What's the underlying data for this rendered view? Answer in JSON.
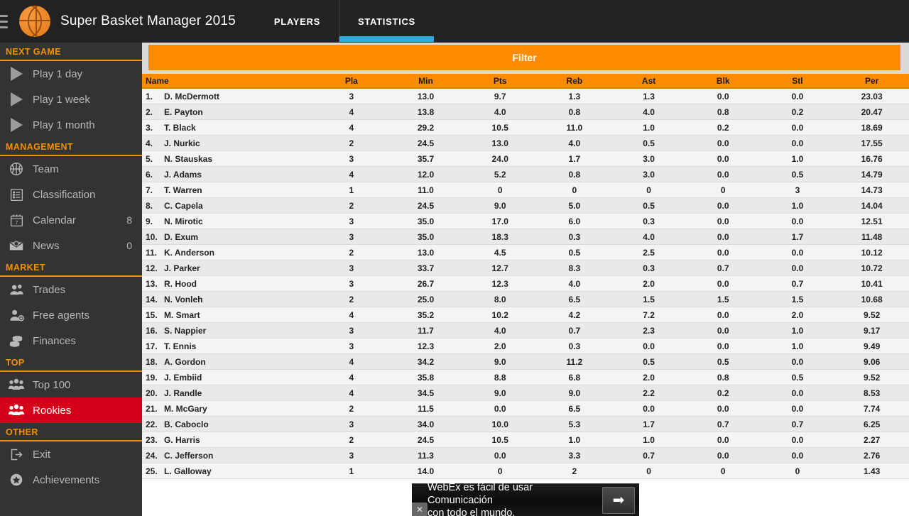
{
  "header": {
    "menu_icon": "hamburger-icon",
    "logo_icon": "basketball-logo-icon",
    "title": "Super Basket Manager 2015",
    "tabs": [
      {
        "label": "PLAYERS",
        "active": false
      },
      {
        "label": "STATISTICS",
        "active": true
      }
    ],
    "accent_tab_color": "#2fadda",
    "bar_color": "#222222"
  },
  "sidebar": {
    "bg_color": "#333333",
    "section_color": "#f39200",
    "selected_color": "#d50019",
    "groups": [
      {
        "title": "NEXT GAME",
        "items": [
          {
            "label": "Play 1 day",
            "icon": "play-icon",
            "badge": ""
          },
          {
            "label": "Play 1 week",
            "icon": "play-icon",
            "badge": ""
          },
          {
            "label": "Play 1 month",
            "icon": "play-icon",
            "badge": ""
          }
        ]
      },
      {
        "title": "MANAGEMENT",
        "items": [
          {
            "label": "Team",
            "icon": "basketball-icon",
            "badge": ""
          },
          {
            "label": "Classification",
            "icon": "list-icon",
            "badge": ""
          },
          {
            "label": "Calendar",
            "icon": "calendar-icon",
            "badge": "8"
          },
          {
            "label": "News",
            "icon": "mail-icon",
            "badge": "0"
          }
        ]
      },
      {
        "title": "MARKET",
        "items": [
          {
            "label": "Trades",
            "icon": "two-people-icon",
            "badge": ""
          },
          {
            "label": "Free agents",
            "icon": "person-add-icon",
            "badge": ""
          },
          {
            "label": "Finances",
            "icon": "coins-icon",
            "badge": ""
          }
        ]
      },
      {
        "title": "TOP",
        "items": [
          {
            "label": "Top 100",
            "icon": "three-people-icon",
            "badge": "",
            "selected": false
          },
          {
            "label": "Rookies",
            "icon": "three-people-icon",
            "badge": "",
            "selected": true
          }
        ]
      },
      {
        "title": "OTHER",
        "items": [
          {
            "label": "Exit",
            "icon": "exit-icon",
            "badge": ""
          },
          {
            "label": "Achievements",
            "icon": "star-icon",
            "badge": ""
          }
        ]
      }
    ]
  },
  "main": {
    "filter_label": "Filter",
    "filter_color": "#ff8c00",
    "columns": [
      "Name",
      "Pla",
      "Min",
      "Pts",
      "Reb",
      "Ast",
      "Blk",
      "Stl",
      "Per"
    ],
    "rows": [
      {
        "rank": "1.",
        "name": "D. McDermott",
        "pla": "3",
        "min": "13.0",
        "pts": "9.7",
        "reb": "1.3",
        "ast": "1.3",
        "blk": "0.0",
        "stl": "0.0",
        "per": "23.03"
      },
      {
        "rank": "2.",
        "name": "E. Payton",
        "pla": "4",
        "min": "13.8",
        "pts": "4.0",
        "reb": "0.8",
        "ast": "4.0",
        "blk": "0.8",
        "stl": "0.2",
        "per": "20.47"
      },
      {
        "rank": "3.",
        "name": "T. Black",
        "pla": "4",
        "min": "29.2",
        "pts": "10.5",
        "reb": "11.0",
        "ast": "1.0",
        "blk": "0.2",
        "stl": "0.0",
        "per": "18.69"
      },
      {
        "rank": "4.",
        "name": "J. Nurkic",
        "pla": "2",
        "min": "24.5",
        "pts": "13.0",
        "reb": "4.0",
        "ast": "0.5",
        "blk": "0.0",
        "stl": "0.0",
        "per": "17.55"
      },
      {
        "rank": "5.",
        "name": "N. Stauskas",
        "pla": "3",
        "min": "35.7",
        "pts": "24.0",
        "reb": "1.7",
        "ast": "3.0",
        "blk": "0.0",
        "stl": "1.0",
        "per": "16.76"
      },
      {
        "rank": "6.",
        "name": "J. Adams",
        "pla": "4",
        "min": "12.0",
        "pts": "5.2",
        "reb": "0.8",
        "ast": "3.0",
        "blk": "0.0",
        "stl": "0.5",
        "per": "14.79"
      },
      {
        "rank": "7.",
        "name": "T. Warren",
        "pla": "1",
        "min": "11.0",
        "pts": "0",
        "reb": "0",
        "ast": "0",
        "blk": "0",
        "stl": "3",
        "per": "14.73"
      },
      {
        "rank": "8.",
        "name": "C. Capela",
        "pla": "2",
        "min": "24.5",
        "pts": "9.0",
        "reb": "5.0",
        "ast": "0.5",
        "blk": "0.0",
        "stl": "1.0",
        "per": "14.04"
      },
      {
        "rank": "9.",
        "name": "N. Mirotic",
        "pla": "3",
        "min": "35.0",
        "pts": "17.0",
        "reb": "6.0",
        "ast": "0.3",
        "blk": "0.0",
        "stl": "0.0",
        "per": "12.51"
      },
      {
        "rank": "10.",
        "name": "D. Exum",
        "pla": "3",
        "min": "35.0",
        "pts": "18.3",
        "reb": "0.3",
        "ast": "4.0",
        "blk": "0.0",
        "stl": "1.7",
        "per": "11.48"
      },
      {
        "rank": "11.",
        "name": "K. Anderson",
        "pla": "2",
        "min": "13.0",
        "pts": "4.5",
        "reb": "0.5",
        "ast": "2.5",
        "blk": "0.0",
        "stl": "0.0",
        "per": "10.12"
      },
      {
        "rank": "12.",
        "name": "J. Parker",
        "pla": "3",
        "min": "33.7",
        "pts": "12.7",
        "reb": "8.3",
        "ast": "0.3",
        "blk": "0.7",
        "stl": "0.0",
        "per": "10.72"
      },
      {
        "rank": "13.",
        "name": "R. Hood",
        "pla": "3",
        "min": "26.7",
        "pts": "12.3",
        "reb": "4.0",
        "ast": "2.0",
        "blk": "0.0",
        "stl": "0.7",
        "per": "10.41"
      },
      {
        "rank": "14.",
        "name": "N. Vonleh",
        "pla": "2",
        "min": "25.0",
        "pts": "8.0",
        "reb": "6.5",
        "ast": "1.5",
        "blk": "1.5",
        "stl": "1.5",
        "per": "10.68"
      },
      {
        "rank": "15.",
        "name": "M. Smart",
        "pla": "4",
        "min": "35.2",
        "pts": "10.2",
        "reb": "4.2",
        "ast": "7.2",
        "blk": "0.0",
        "stl": "2.0",
        "per": "9.52"
      },
      {
        "rank": "16.",
        "name": "S. Nappier",
        "pla": "3",
        "min": "11.7",
        "pts": "4.0",
        "reb": "0.7",
        "ast": "2.3",
        "blk": "0.0",
        "stl": "1.0",
        "per": "9.17"
      },
      {
        "rank": "17.",
        "name": "T. Ennis",
        "pla": "3",
        "min": "12.3",
        "pts": "2.0",
        "reb": "0.3",
        "ast": "0.0",
        "blk": "0.0",
        "stl": "1.0",
        "per": "9.49"
      },
      {
        "rank": "18.",
        "name": "A. Gordon",
        "pla": "4",
        "min": "34.2",
        "pts": "9.0",
        "reb": "11.2",
        "ast": "0.5",
        "blk": "0.5",
        "stl": "0.0",
        "per": "9.06"
      },
      {
        "rank": "19.",
        "name": "J. Embiid",
        "pla": "4",
        "min": "35.8",
        "pts": "8.8",
        "reb": "6.8",
        "ast": "2.0",
        "blk": "0.8",
        "stl": "0.5",
        "per": "9.52"
      },
      {
        "rank": "20.",
        "name": "J. Randle",
        "pla": "4",
        "min": "34.5",
        "pts": "9.0",
        "reb": "9.0",
        "ast": "2.2",
        "blk": "0.2",
        "stl": "0.0",
        "per": "8.53"
      },
      {
        "rank": "21.",
        "name": "M. McGary",
        "pla": "2",
        "min": "11.5",
        "pts": "0.0",
        "reb": "6.5",
        "ast": "0.0",
        "blk": "0.0",
        "stl": "0.0",
        "per": "7.74"
      },
      {
        "rank": "22.",
        "name": "B. Caboclo",
        "pla": "3",
        "min": "34.0",
        "pts": "10.0",
        "reb": "5.3",
        "ast": "1.7",
        "blk": "0.7",
        "stl": "0.7",
        "per": "6.25"
      },
      {
        "rank": "23.",
        "name": "G. Harris",
        "pla": "2",
        "min": "24.5",
        "pts": "10.5",
        "reb": "1.0",
        "ast": "1.0",
        "blk": "0.0",
        "stl": "0.0",
        "per": "2.27"
      },
      {
        "rank": "24.",
        "name": "C. Jefferson",
        "pla": "3",
        "min": "11.3",
        "pts": "0.0",
        "reb": "3.3",
        "ast": "0.7",
        "blk": "0.0",
        "stl": "0.0",
        "per": "2.76"
      },
      {
        "rank": "25.",
        "name": "L. Galloway",
        "pla": "1",
        "min": "14.0",
        "pts": "0",
        "reb": "2",
        "ast": "0",
        "blk": "0",
        "stl": "0",
        "per": "1.43"
      }
    ]
  },
  "ad": {
    "line1": "WebEx es fácil de usar Comunicación",
    "line2": "con todo el mundo.",
    "arrow": "➡",
    "close": "✕"
  }
}
